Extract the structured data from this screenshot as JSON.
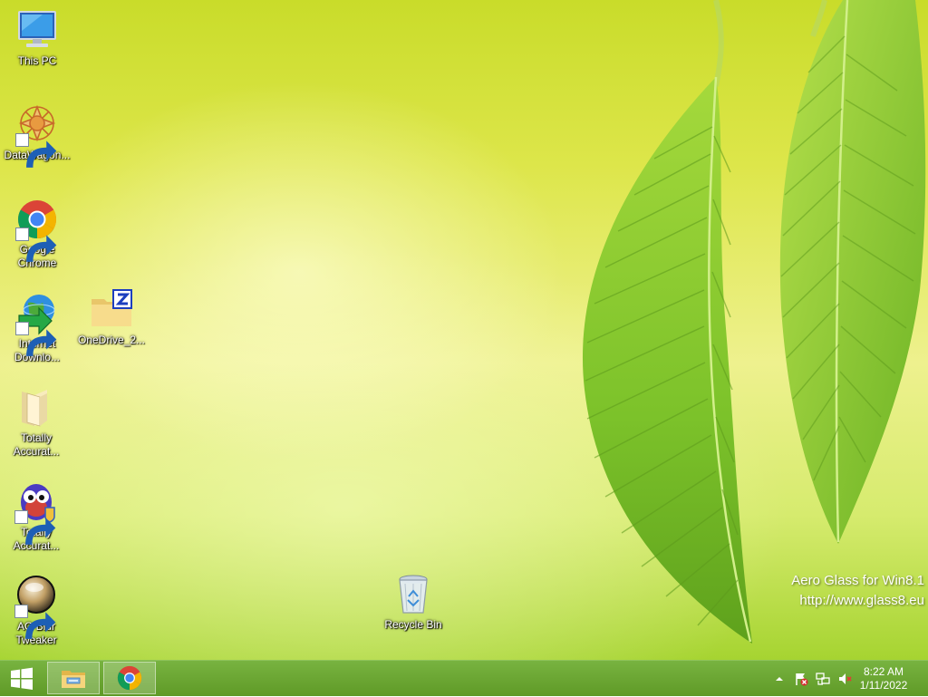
{
  "desktop": {
    "icons": [
      {
        "label": "This PC"
      },
      {
        "label": "DataWagon..."
      },
      {
        "label": "Google Chrome"
      },
      {
        "label": "Internet Downlo..."
      },
      {
        "label": "OneDrive_2..."
      },
      {
        "label": "Totally Accurat..."
      },
      {
        "label": "Totally Accurat..."
      },
      {
        "label": "AG Blur Tweaker"
      },
      {
        "label": "Recycle Bin"
      }
    ],
    "watermark": {
      "line1": "Aero Glass for Win8.1",
      "line2": "http://www.glass8.eu"
    }
  },
  "taskbar": {
    "start_icon": "windows-logo-icon",
    "pinned": [
      {
        "icon": "file-explorer-icon"
      },
      {
        "icon": "chrome-icon"
      }
    ],
    "tray": {
      "icons": [
        "chevron-up-icon",
        "action-center-flag-icon",
        "network-icon",
        "speaker-muted-icon"
      ]
    },
    "clock": {
      "time": "8:22 AM",
      "date": "1/11/2022"
    }
  },
  "colors": {
    "taskbar": "#6aa630",
    "wallpaper_base": "#dde64a",
    "leaf": "#7cc22a"
  }
}
